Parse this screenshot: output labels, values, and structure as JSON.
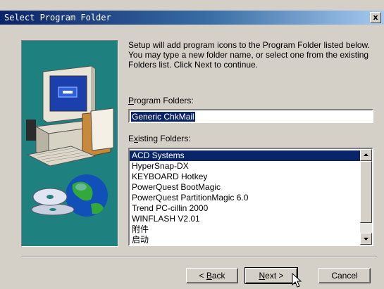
{
  "window": {
    "title": "Select Program Folder",
    "close_glyph": "x"
  },
  "instructions": "Setup will add program icons to the Program Folder listed below.\nYou may type a new folder name, or select one from the existing\nFolders list.  Click Next to continue.",
  "program_folders": {
    "label_prefix": "",
    "label_accel": "P",
    "label_rest": "rogram Folders:",
    "value": "Generic ChkMail"
  },
  "existing_folders": {
    "label_prefix": "E",
    "label_accel": "x",
    "label_rest": "isting Folders:",
    "items": [
      "ACD Systems",
      "HyperSnap-DX",
      "KEYBOARD Hotkey",
      "PowerQuest BootMagic",
      "PowerQuest PartitionMagic 6.0",
      "Trend PC-cillin 2000",
      "WINFLASH V2.01",
      "附件",
      "启动"
    ],
    "selected": "ACD Systems"
  },
  "buttons": {
    "back_pre": "< ",
    "back_accel": "B",
    "back_rest": "ack",
    "next_accel": "N",
    "next_rest": "ext >",
    "cancel": "Cancel"
  },
  "colors": {
    "title_gradient_start": "#0a246a",
    "selection": "#0a246a",
    "dialog_face": "#d4d0c8",
    "art_background": "#1f8080"
  },
  "icons": [
    "computer-illustration",
    "globe-icon",
    "cd-discs-icon",
    "mouse-cursor-icon",
    "close-icon"
  ]
}
